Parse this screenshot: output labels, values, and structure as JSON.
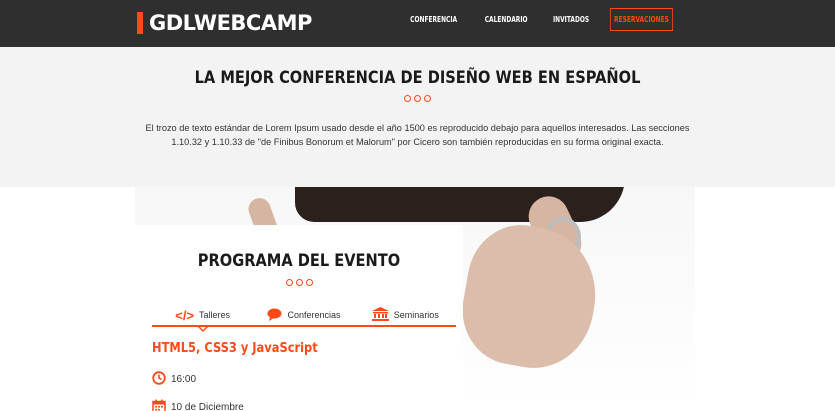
{
  "header": {
    "logo": "GDLWEBCAMP",
    "nav": [
      {
        "label": "CONFERENCIA"
      },
      {
        "label": "CALENDARIO"
      },
      {
        "label": "INVITADOS"
      },
      {
        "label": "RESERVACIONES"
      }
    ],
    "accent": "#fe4918",
    "background": "#2f2f2f"
  },
  "intro": {
    "title": "LA MEJOR CONFERENCIA DE DISEÑO WEB EN ESPAÑOL",
    "text": "El trozo de texto estándar de Lorem Ipsum usado desde el año 1500 es reproducido debajo para aquellos interesados. Las secciones 1.10.32 y 1.10.33 de \"de Finibus Bonorum et Malorum\" por Cicero son también reproducidas en su forma original exacta."
  },
  "program": {
    "title": "PROGRAMA DEL EVENTO",
    "tabs": [
      {
        "label": "Talleres",
        "icon": "code-icon",
        "active": true
      },
      {
        "label": "Conferencias",
        "icon": "comment-icon",
        "active": false
      },
      {
        "label": "Seminarios",
        "icon": "university-icon",
        "active": false
      }
    ],
    "event": {
      "title": "HTML5, CSS3 y JavaScript",
      "time": "16:00",
      "date": "10 de Diciembre"
    }
  }
}
